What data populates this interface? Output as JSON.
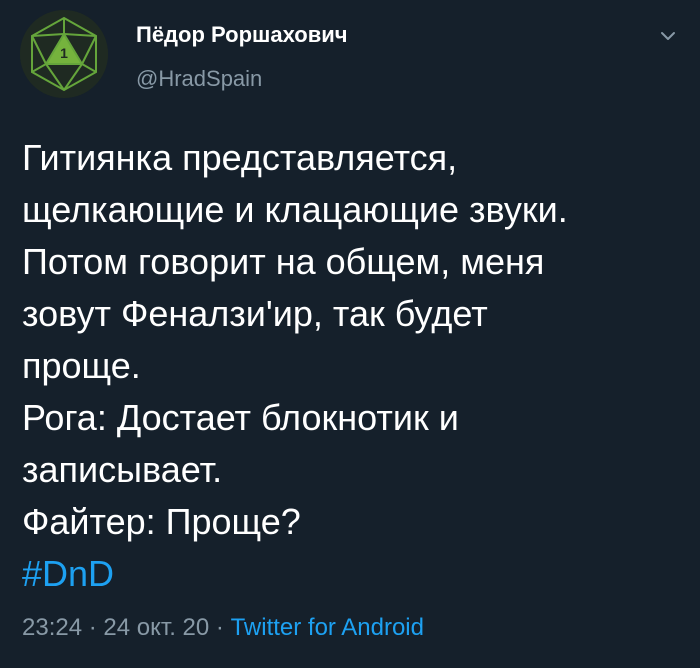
{
  "author": {
    "display_name": "Пёдор Роршахович",
    "handle": "@HradSpain",
    "avatar_label": "1"
  },
  "tweet": {
    "lines": [
      "Гитиянка представляется,",
      "щелкающие и клацающие звуки.",
      "Потом говорит на общем, меня",
      "зовут Феналзи'ир, так будет",
      "проще.",
      "Рога: Достает блокнотик и",
      "записывает.",
      "Файтер: Проще?"
    ],
    "hashtag": "#DnD"
  },
  "meta": {
    "time": "23:24",
    "separator1": " · ",
    "date": "24 окт. 20",
    "separator2": " · ",
    "source": "Twitter for Android"
  },
  "colors": {
    "background": "#15202b",
    "text": "#ffffff",
    "secondary": "#8899a6",
    "accent": "#1da1f2"
  },
  "icons": {
    "avatar": "d20-dice-icon",
    "menu": "chevron-down-icon"
  }
}
